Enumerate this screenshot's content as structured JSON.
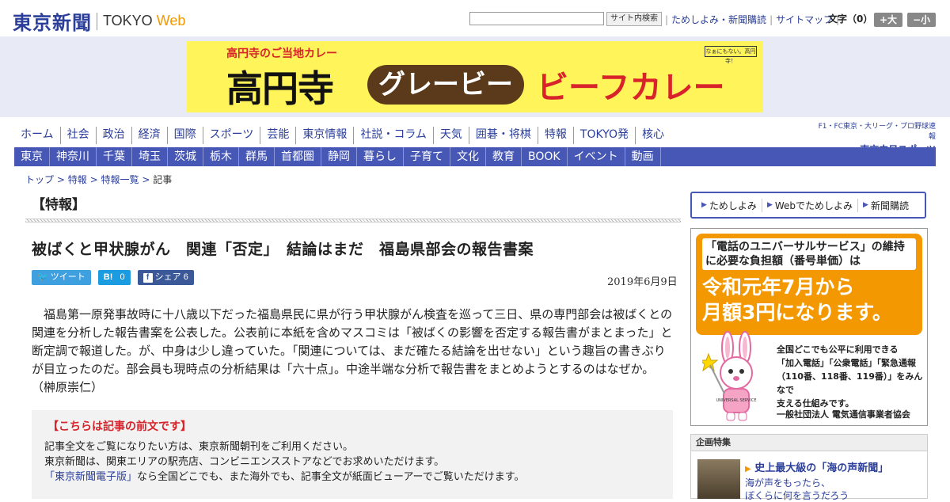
{
  "header": {
    "logo_jp": "東京新聞",
    "logo_en": "TOKYO",
    "logo_web": "Web",
    "search_button": "サイト内検索",
    "links": [
      "ためしよみ・新聞購読",
      "サイトマップ"
    ],
    "font_size_label": "文字（0）",
    "font_up": "+大",
    "font_down": "−小"
  },
  "banner": {
    "subtitle": "高円寺のご当地カレー",
    "main": "高円寺",
    "pill": "グレービー",
    "red": "ビーフカレー",
    "stamp": "なぁにもない。高円寺！"
  },
  "nav_primary": [
    "ホーム",
    "社会",
    "政治",
    "経済",
    "国際",
    "スポーツ",
    "芸能",
    "東京情報",
    "社説・コラム",
    "天気",
    "囲碁・将棋",
    "特報",
    "TOKYO発",
    "核心"
  ],
  "nav_secondary": [
    "東京",
    "神奈川",
    "千葉",
    "埼玉",
    "茨城",
    "栃木",
    "群馬",
    "首都圏",
    "静岡",
    "暮らし",
    "子育て",
    "文化",
    "教育",
    "BOOK",
    "イベント",
    "動画"
  ],
  "chunichi": {
    "line1": "F1・FC東京・大リーグ・プロ野球速報",
    "line2": "東京中日スポーツ"
  },
  "breadcrumb": {
    "items": [
      "トップ",
      "特報",
      "特報一覧"
    ],
    "current": "記事",
    "separator": ">"
  },
  "section_title": "【特報】",
  "article": {
    "headline": "被ばくと甲状腺がん　関連「否定」　結論はまだ　福島県部会の報告書案",
    "date": "2019年6月9日",
    "social": {
      "tweet": "ツイート",
      "hatena_label": "B!",
      "hatena_count": "0",
      "share_label": "シェア",
      "share_count": "6"
    },
    "body": "福島第一原発事故時に十八歳以下だった福島県民に県が行う甲状腺がん検査を巡って三日、県の専門部会は被ばくとの関連を分析した報告書案を公表した。公表前に本紙を含めマスコミは「被ばくの影響を否定する報告書がまとまった」と断定調で報道した。が、中身は少し違っていた。「関連については、まだ確たる結論を出せない」という趣旨の書きぶりが目立ったのだ。部会員も現時点の分析結果は「六十点」。中途半端な分析で報告書をまとめようとするのはなぜか。　（榊原崇仁）"
  },
  "notice": {
    "title": "【こちらは記事の前文です】",
    "line1": "記事全文をご覧になりたい方は、東京新聞朝刊をご利用ください。",
    "line2": "東京新聞は、関東エリアの駅売店、コンビニエンスストアなどでお求めいただけます。",
    "link": "「東京新聞電子版」",
    "line3_rest": "なら全国どこでも、また海外でも、記事全文が紙面ビューアーでご覧いただけます。"
  },
  "sidebar": {
    "subscribe": [
      "ためしよみ",
      "Webでためしよみ",
      "新聞購読"
    ],
    "ad": {
      "head": "「電話のユニバーサルサービス」の維持に必要な負担額（番号単価）は",
      "big1": "令和元年7月から",
      "big2": "月額3円になります。",
      "small1": "全国どこでも公平に利用できる",
      "small2": "「加入電話」「公衆電話」「緊急通報",
      "small3": "（110番、118番、119番）」をみんなで",
      "small4": "支える仕組みです。",
      "footer": "一般社団法人 電気通信事業者協会",
      "mascot_label": "UNIVERSAL SERVICE"
    },
    "kikaku": {
      "header": "企画特集",
      "title": "史上最大級の「海の声新聞」",
      "text1": "海が声をもったら、",
      "text2": "ぼくらに何を言うだろう"
    }
  },
  "colors": {
    "brand_blue": "#2a3e9a",
    "nav_blue": "#4657b5",
    "accent_orange": "#f39800",
    "alert_red": "#d8232a"
  }
}
